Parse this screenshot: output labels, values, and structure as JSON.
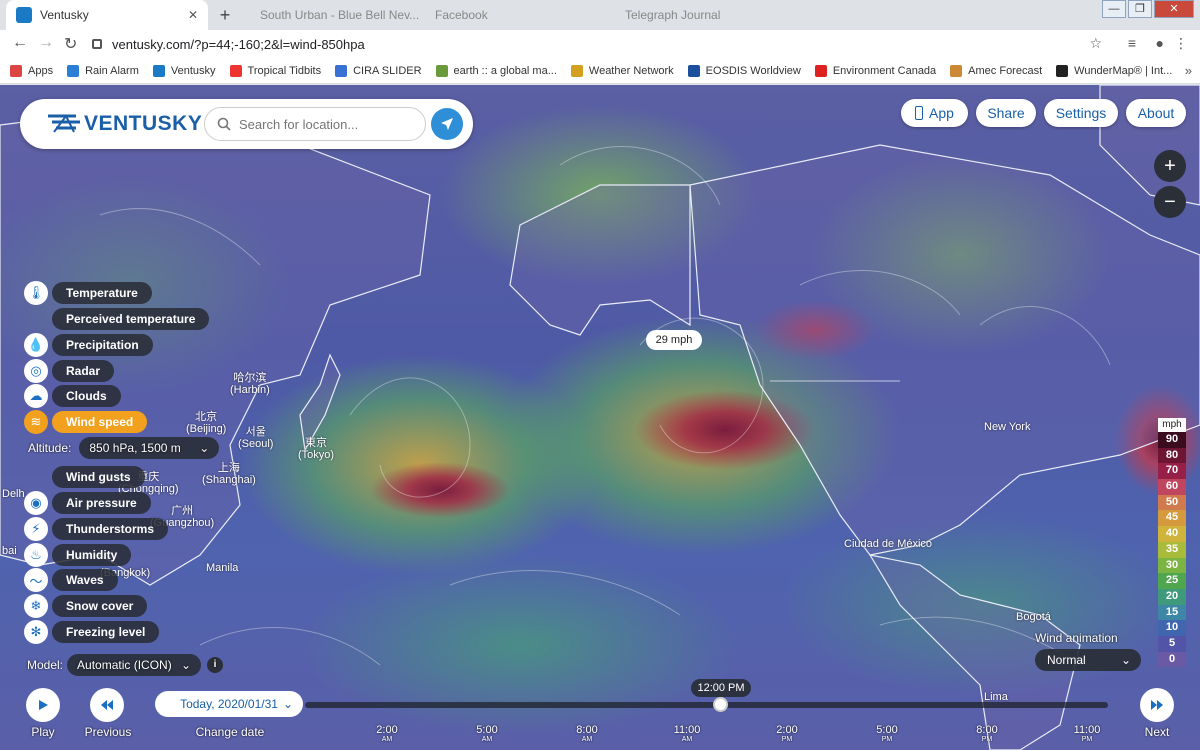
{
  "browser": {
    "active_tab_title": "Ventusky",
    "background_tabs": [
      "South Urban - Blue Bell Nev...",
      "Facebook",
      "Telegraph Journal"
    ],
    "url": "ventusky.com/?p=44;-160;2&l=wind-850hpa",
    "bookmarks": [
      {
        "label": "Apps",
        "color": "#d44"
      },
      {
        "label": "Rain Alarm",
        "color": "#2a7fd4"
      },
      {
        "label": "Ventusky",
        "color": "#1b7ac6"
      },
      {
        "label": "Tropical Tidbits",
        "color": "#e33"
      },
      {
        "label": "CIRA SLIDER",
        "color": "#3a6fd4"
      },
      {
        "label": "earth :: a global ma...",
        "color": "#6a9a3a"
      },
      {
        "label": "Weather Network",
        "color": "#d4a020"
      },
      {
        "label": "EOSDIS Worldview",
        "color": "#1c4f9c"
      },
      {
        "label": "Environment Canada",
        "color": "#d22"
      },
      {
        "label": "Amec Forecast",
        "color": "#c83"
      },
      {
        "label": "WunderMap® | Int...",
        "color": "#222"
      }
    ]
  },
  "app": {
    "brand": "VENTUSKY",
    "search_placeholder": "Search for location...",
    "top_buttons": {
      "app": "App",
      "share": "Share",
      "settings": "Settings",
      "about": "About"
    },
    "zoom_in": "+",
    "zoom_out": "−"
  },
  "layers": [
    {
      "label": "Temperature",
      "icon": "thermometer-icon",
      "glyph": "🌡",
      "active": false
    },
    {
      "label": "Perceived temperature",
      "icon": "",
      "glyph": "",
      "active": false
    },
    {
      "label": "Precipitation",
      "icon": "droplet-icon",
      "glyph": "💧",
      "active": false
    },
    {
      "label": "Radar",
      "icon": "radar-icon",
      "glyph": "◎",
      "active": false
    },
    {
      "label": "Clouds",
      "icon": "cloud-icon",
      "glyph": "☁",
      "active": false
    },
    {
      "label": "Wind speed",
      "icon": "wind-icon",
      "glyph": "≋",
      "active": true
    },
    {
      "label": "Wind gusts",
      "icon": "",
      "glyph": "",
      "active": false
    },
    {
      "label": "Air pressure",
      "icon": "pressure-icon",
      "glyph": "◉",
      "active": false
    },
    {
      "label": "Thunderstorms",
      "icon": "lightning-icon",
      "glyph": "⚡",
      "active": false
    },
    {
      "label": "Humidity",
      "icon": "humidity-icon",
      "glyph": "♨",
      "active": false
    },
    {
      "label": "Waves",
      "icon": "waves-icon",
      "glyph": "〜",
      "active": false
    },
    {
      "label": "Snow cover",
      "icon": "snowflake-icon",
      "glyph": "❄",
      "active": false
    },
    {
      "label": "Freezing level",
      "icon": "freezing-icon",
      "glyph": "✻",
      "active": false
    }
  ],
  "altitude": {
    "label": "Altitude:",
    "value": "850 hPa, 1500 m"
  },
  "model": {
    "label": "Model:",
    "value": "Automatic (ICON)"
  },
  "tooltip": "29 mph",
  "legend": {
    "unit": "mph",
    "entries": [
      {
        "v": "90",
        "c": "#3a0c1e"
      },
      {
        "v": "80",
        "c": "#6e1534"
      },
      {
        "v": "70",
        "c": "#962048"
      },
      {
        "v": "60",
        "c": "#c04660"
      },
      {
        "v": "50",
        "c": "#d07a4e"
      },
      {
        "v": "45",
        "c": "#d69a3e"
      },
      {
        "v": "40",
        "c": "#cfb33a"
      },
      {
        "v": "35",
        "c": "#a9bb3a"
      },
      {
        "v": "30",
        "c": "#7cb444"
      },
      {
        "v": "25",
        "c": "#4fa64e"
      },
      {
        "v": "20",
        "c": "#3e9a7a"
      },
      {
        "v": "15",
        "c": "#3d86a6"
      },
      {
        "v": "10",
        "c": "#4066b0"
      },
      {
        "v": "5",
        "c": "#5254a8"
      },
      {
        "v": "0",
        "c": "#6a5aa6"
      }
    ]
  },
  "wind_animation": {
    "label": "Wind animation",
    "value": "Normal"
  },
  "cities": [
    {
      "label": "哈尔滨\n(Harbin)"
    },
    {
      "label": "北京\n(Beijing)"
    },
    {
      "label": "서울\n(Seoul)"
    },
    {
      "label": "東京\n(Tokyo)"
    },
    {
      "label": "上海\n(Shanghai)"
    },
    {
      "label": "重庆\n(Chongqing)"
    },
    {
      "label": "广州\n(Guangzhou)"
    },
    {
      "label": "Manila"
    },
    {
      "label": "(Bangkok)"
    },
    {
      "label": "New York"
    },
    {
      "label": "Ciudad de México"
    },
    {
      "label": "Bogotá"
    },
    {
      "label": "Lima"
    },
    {
      "label": "Delh"
    },
    {
      "label": "bai"
    }
  ],
  "timeline": {
    "play": "Play",
    "previous": "Previous",
    "change_date": "Change date",
    "next": "Next",
    "date": "Today, 2020/01/31",
    "current_time": "12:00 PM",
    "ticks": [
      {
        "t": "2:00",
        "ap": "AM"
      },
      {
        "t": "5:00",
        "ap": "AM"
      },
      {
        "t": "8:00",
        "ap": "AM"
      },
      {
        "t": "11:00",
        "ap": "AM"
      },
      {
        "t": "2:00",
        "ap": "PM"
      },
      {
        "t": "5:00",
        "ap": "PM"
      },
      {
        "t": "8:00",
        "ap": "PM"
      },
      {
        "t": "11:00",
        "ap": "PM"
      }
    ]
  }
}
